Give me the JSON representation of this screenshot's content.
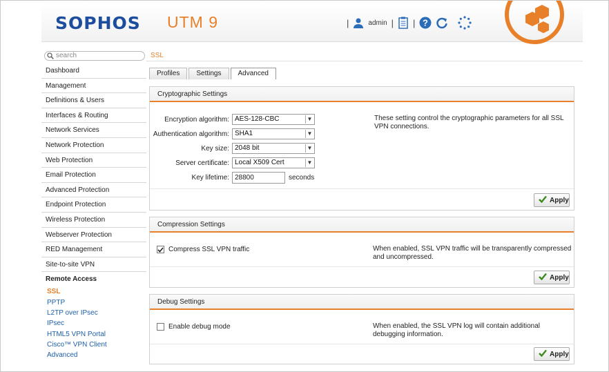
{
  "header": {
    "logo": "SOPHOS",
    "product": "UTM 9",
    "user": "admin",
    "brand_color": "#1d4e9e",
    "accent_color": "#e8802a"
  },
  "sidebar": {
    "search_placeholder": "search",
    "items": [
      {
        "label": "Dashboard"
      },
      {
        "label": "Management"
      },
      {
        "label": "Definitions & Users"
      },
      {
        "label": "Interfaces & Routing"
      },
      {
        "label": "Network Services"
      },
      {
        "label": "Network Protection"
      },
      {
        "label": "Web Protection"
      },
      {
        "label": "Email Protection"
      },
      {
        "label": "Advanced Protection"
      },
      {
        "label": "Endpoint Protection"
      },
      {
        "label": "Wireless Protection"
      },
      {
        "label": "Webserver Protection"
      },
      {
        "label": "RED Management"
      },
      {
        "label": "Site-to-site VPN"
      }
    ],
    "section": "Remote Access",
    "subitems": [
      {
        "label": "SSL"
      },
      {
        "label": "PPTP"
      },
      {
        "label": "L2TP over IPsec"
      },
      {
        "label": "IPsec"
      },
      {
        "label": "HTML5 VPN Portal"
      },
      {
        "label": "Cisco™ VPN Client"
      },
      {
        "label": "Advanced"
      }
    ]
  },
  "main": {
    "breadcrumb": "SSL",
    "tabs": [
      {
        "label": "Profiles"
      },
      {
        "label": "Settings"
      },
      {
        "label": "Advanced"
      }
    ],
    "crypto": {
      "title": "Cryptographic Settings",
      "enc_label": "Encryption algorithm:",
      "enc_value": "AES-128-CBC",
      "auth_label": "Authentication algorithm:",
      "auth_value": "SHA1",
      "keysize_label": "Key size:",
      "keysize_value": "2048 bit",
      "cert_label": "Server certificate:",
      "cert_value": "Local X509 Cert",
      "lifetime_label": "Key lifetime:",
      "lifetime_value": "28800",
      "lifetime_unit": "seconds",
      "description": "These setting control the cryptographic parameters for all SSL VPN connections.",
      "apply": "Apply"
    },
    "compression": {
      "title": "Compression Settings",
      "checkbox_label": "Compress SSL VPN traffic",
      "checked": true,
      "description": "When enabled, SSL VPN traffic will be transparently compressed and uncompressed.",
      "apply": "Apply"
    },
    "debug": {
      "title": "Debug Settings",
      "checkbox_label": "Enable debug mode",
      "checked": false,
      "description": "When enabled, the SSL VPN log will contain additional debugging information.",
      "apply": "Apply"
    }
  }
}
